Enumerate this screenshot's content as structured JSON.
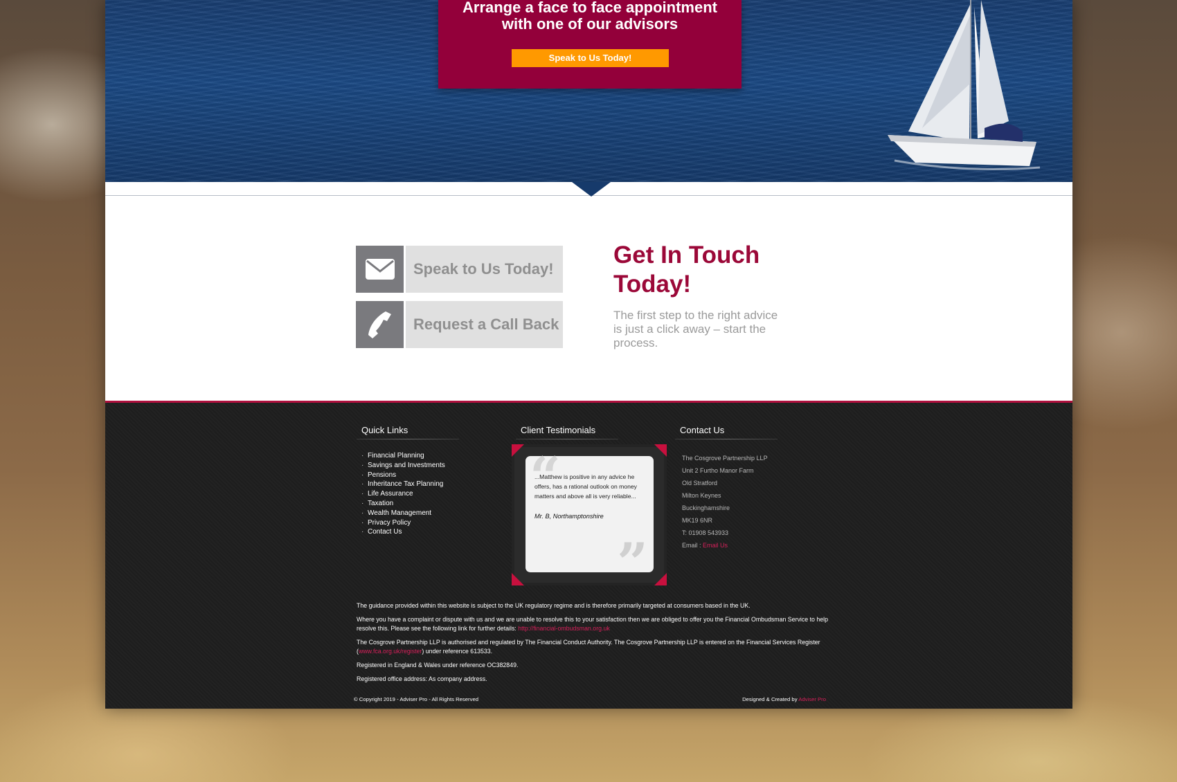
{
  "hero": {
    "heading": "Arrange a face to face appointment\nwith one of our advisors",
    "button_label": "Speak to Us Today!"
  },
  "contact_section": {
    "speak_button": "Speak to Us Today!",
    "call_button": "Request a Call Back",
    "title": "Get In Touch Today!",
    "text": "The first step to the right advice is just a click away – start the process."
  },
  "footer": {
    "quick_links": {
      "title": "Quick Links",
      "items": [
        "Financial Planning",
        "Savings and Investments",
        "Pensions",
        "Inheritance Tax Planning",
        "Life Assurance",
        "Taxation",
        "Wealth Management",
        "Privacy Policy",
        "Contact Us"
      ]
    },
    "testimonials": {
      "title": "Client Testimonials",
      "quote": "...Matthew is positive in any advice he offers, has a rational outlook on money matters and above all is very reliable...",
      "author": "Mr. B, Northamptonshire"
    },
    "contact": {
      "title": "Contact Us",
      "lines": [
        "The Cosgrove Partnership LLP",
        "Unit 2 Furtho Manor Farm",
        "Old Stratford",
        "Milton Keynes",
        "Buckinghamshire",
        "MK19 6NR",
        "T: 01908 543933"
      ],
      "email_label": "Email :",
      "email_link": "Email Us"
    },
    "legal": {
      "p1": "The guidance provided within this website is subject to the UK regulatory regime and is therefore primarily targeted at consumers based in the UK.",
      "p2_text": "Where you have a complaint or dispute with us and we are unable to resolve this to your satisfaction then we are obliged to offer you the Financial Ombudsman Service to help resolve this. Please see the following link for further details: ",
      "p2_link": "http://financial-ombudsman.org.uk",
      "p3_text_a": "The Cosgrove Partnership LLP is authorised and regulated by The Financial Conduct Authority. The Cosgrove Partnership LLP is entered on the Financial Services Register (",
      "p3_link": "www.fca.org.uk/register",
      "p3_text_b": ") under reference 613533.",
      "p4": "Registered in England & Wales under reference OC382849.",
      "p5": "Registered office address: As company address."
    },
    "copyright": "© Copyright 2019 - Adviser Pro - All Rights Reserved",
    "credits_label": "Designed & Created by ",
    "credits_link": "Adviser Pro"
  },
  "colors": {
    "brand_crimson": "#93003a",
    "cta_orange": "#ff9900",
    "link_pink": "#d6205a",
    "footer_bg": "#1e1e1e"
  },
  "icons": [
    "envelope-icon",
    "phone-icon",
    "quote-open-icon",
    "quote-close-icon",
    "sailboat-image"
  ]
}
